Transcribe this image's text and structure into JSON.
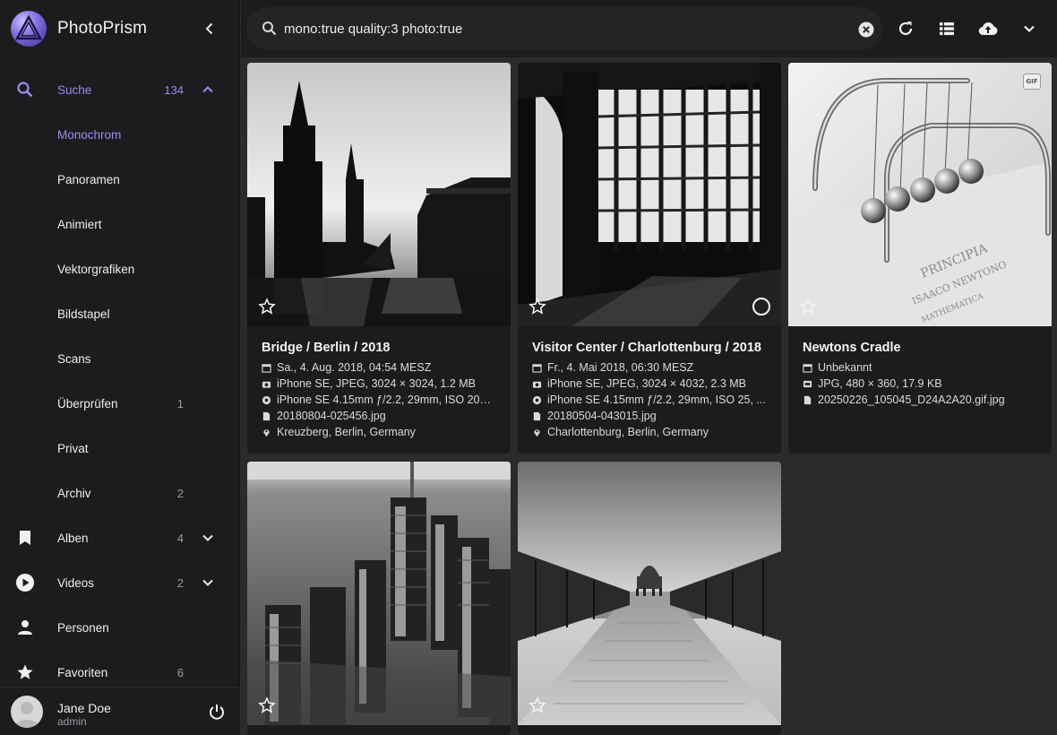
{
  "app": {
    "name": "PhotoPrism"
  },
  "search": {
    "query": "mono:true quality:3 photo:true"
  },
  "sidebar": {
    "search_item": {
      "label": "Suche",
      "count": "134"
    },
    "sub_items": [
      {
        "label": "Monochrom",
        "count": ""
      },
      {
        "label": "Panoramen",
        "count": ""
      },
      {
        "label": "Animiert",
        "count": ""
      },
      {
        "label": "Vektorgrafiken",
        "count": ""
      },
      {
        "label": "Bildstapel",
        "count": ""
      },
      {
        "label": "Scans",
        "count": ""
      },
      {
        "label": "Überprüfen",
        "count": "1"
      },
      {
        "label": "Privat",
        "count": ""
      },
      {
        "label": "Archiv",
        "count": "2"
      }
    ],
    "main_items": [
      {
        "label": "Alben",
        "count": "4",
        "icon": "bookmark-icon"
      },
      {
        "label": "Videos",
        "count": "2",
        "icon": "play-circle-icon"
      },
      {
        "label": "Personen",
        "count": "",
        "icon": "person-icon"
      },
      {
        "label": "Favoriten",
        "count": "6",
        "icon": "star-icon"
      }
    ]
  },
  "user": {
    "name": "Jane Doe",
    "role": "admin"
  },
  "cards": [
    {
      "title": "Bridge / Berlin / 2018",
      "date": "Sa., 4. Aug. 2018, 04:54 MESZ",
      "file_info": "iPhone SE, JPEG, 3024 × 3024, 1.2 MB",
      "camera": "iPhone SE 4.15mm ƒ/2.2, 29mm, ISO 200,...",
      "filename": "20180804-025456.jpg",
      "location": "Kreuzberg, Berlin, Germany"
    },
    {
      "title": "Visitor Center / Charlottenburg / 2018",
      "date": "Fr., 4. Mai 2018, 06:30 MESZ",
      "file_info": "iPhone SE, JPEG, 3024 × 4032, 2.3 MB",
      "camera": "iPhone SE 4.15mm ƒ/2.2, 29mm, ISO 25, ...",
      "filename": "20180504-043015.jpg",
      "location": "Charlottenburg, Berlin, Germany"
    },
    {
      "title": "Newtons Cradle",
      "date": "Unbekannt",
      "file_info": "JPG, 480 × 360, 17.9 KB",
      "filename": "20250226_105045_D24A2A20.gif.jpg",
      "badge": "GIF"
    }
  ],
  "colors": {
    "accent": "#9c8cf0",
    "sidebar_bg": "#1c1c1e",
    "content_bg": "#2b2b2d"
  }
}
